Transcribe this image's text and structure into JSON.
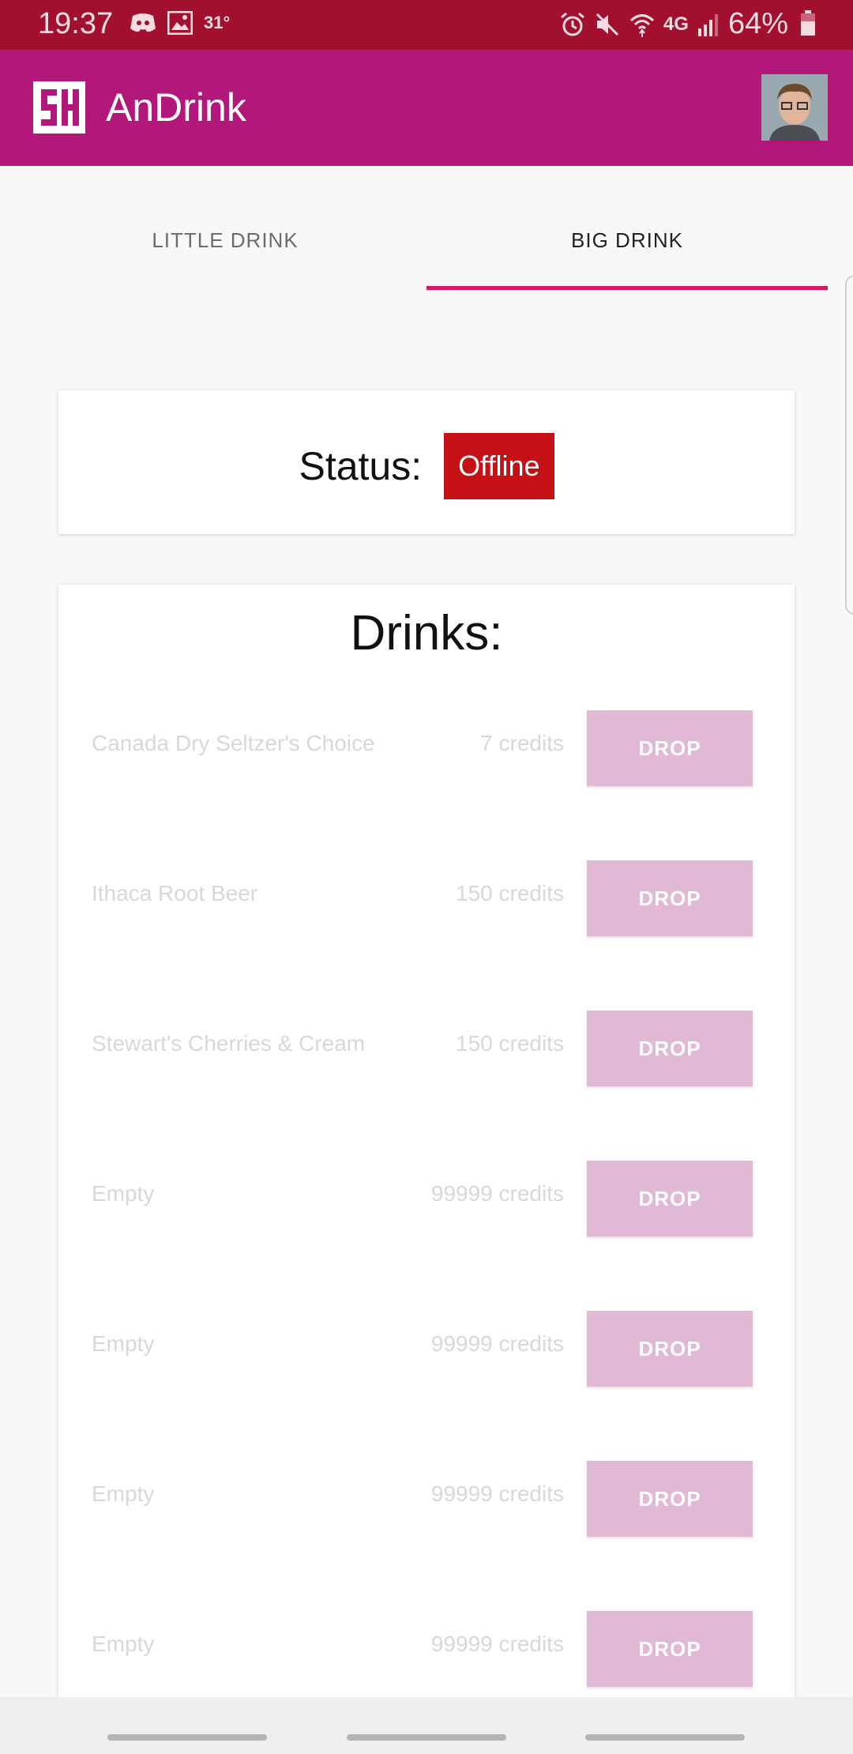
{
  "status_bar": {
    "time": "19:37",
    "temp": "31°",
    "battery_pct": "64%",
    "network": "4G",
    "icons": [
      "discord-icon",
      "image-icon",
      "alarm-icon",
      "mute-icon",
      "wifi-icon",
      "signal-icon",
      "battery-icon"
    ]
  },
  "app_bar": {
    "title": "AnDrink",
    "logo_icon": "csh-logo-icon",
    "avatar_icon": "user-avatar",
    "color": "#b21879"
  },
  "tabs": [
    {
      "label": "LITTLE DRINK",
      "selected": false
    },
    {
      "label": "BIG DRINK",
      "selected": true
    }
  ],
  "status": {
    "label": "Status:",
    "value": "Offline",
    "color": "#c41116"
  },
  "drinks": {
    "title": "Drinks:",
    "items": [
      {
        "name": "Canada Dry Seltzer's Choice",
        "price": "7 credits",
        "button": "DROP"
      },
      {
        "name": "Ithaca Root Beer",
        "price": "150 credits",
        "button": "DROP"
      },
      {
        "name": "Stewart's Cherries & Cream",
        "price": "150 credits",
        "button": "DROP"
      },
      {
        "name": "Empty",
        "price": "99999 credits",
        "button": "DROP"
      },
      {
        "name": "Empty",
        "price": "99999 credits",
        "button": "DROP"
      },
      {
        "name": "Empty",
        "price": "99999 credits",
        "button": "DROP"
      },
      {
        "name": "Empty",
        "price": "99999 credits",
        "button": "DROP"
      }
    ]
  },
  "colors": {
    "status_bar": "#a2102f",
    "accent": "#d81b60",
    "drop_button_disabled": "#e1b9d5"
  }
}
